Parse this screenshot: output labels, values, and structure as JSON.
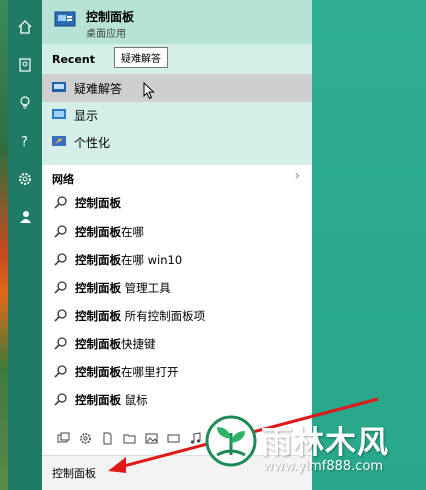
{
  "best_match": {
    "title": "控制面板",
    "subtitle": "桌面应用"
  },
  "recent": {
    "header": "Recent",
    "tooltip": "疑难解答",
    "items": [
      {
        "label": "疑难解答",
        "icon": "troubleshoot-icon"
      },
      {
        "label": "显示",
        "icon": "display-icon"
      },
      {
        "label": "个性化",
        "icon": "personalize-icon"
      }
    ]
  },
  "web": {
    "header": "网络",
    "items": [
      {
        "bold": "控制面板",
        "rest": ""
      },
      {
        "bold": "控制面板",
        "rest": "在哪"
      },
      {
        "bold": "控制面板",
        "rest": "在哪 win10"
      },
      {
        "bold": "控制面板",
        "rest": " 管理工具"
      },
      {
        "bold": "控制面板",
        "rest": " 所有控制面板项"
      },
      {
        "bold": "控制面板",
        "rest": "快捷键"
      },
      {
        "bold": "控制面板",
        "rest": "在哪里打开"
      },
      {
        "bold": "控制面板",
        "rest": " 鼠标"
      }
    ]
  },
  "search": {
    "query": "控制面板"
  },
  "watermark": {
    "title": "雨林木风",
    "url": "www.ylmf888.com"
  },
  "colors": {
    "accent": "#1f7a66",
    "best_bg": "#b6e3d6",
    "recent_bg": "#d3efe7",
    "highlight": "#cfcfcf",
    "arrow": "#e01818"
  }
}
